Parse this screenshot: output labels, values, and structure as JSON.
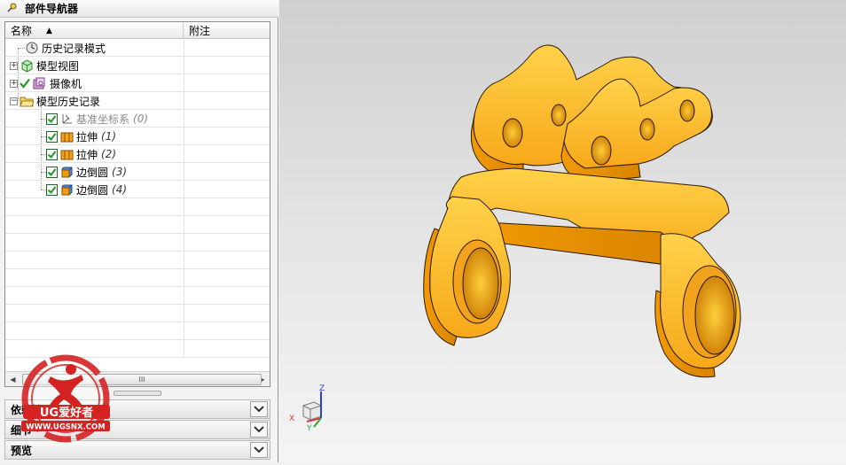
{
  "navigator": {
    "title": "部件导航器",
    "columns": {
      "name": "名称",
      "note": "附注"
    },
    "tree": [
      {
        "label": "历史记录模式",
        "count": ""
      },
      {
        "label": "模型视图",
        "count": ""
      },
      {
        "label": "摄像机",
        "count": ""
      },
      {
        "label": "模型历史记录",
        "count": ""
      },
      {
        "label": "基准坐标系",
        "count": "(0)"
      },
      {
        "label": "拉伸",
        "count": "(1)"
      },
      {
        "label": "拉伸",
        "count": "(2)"
      },
      {
        "label": "边倒圆",
        "count": "(3)"
      },
      {
        "label": "边倒圆",
        "count": "(4)"
      }
    ],
    "scroll_thumb": "III",
    "panels": [
      {
        "label": "依赖性"
      },
      {
        "label": "细节"
      },
      {
        "label": "预览"
      }
    ]
  },
  "watermark": {
    "brand": "UG爱好者",
    "url": "WWW.UGSNX.COM"
  },
  "triad": {
    "x": "X",
    "y": "Y",
    "z": "Z"
  },
  "colors": {
    "part": "#f39a06",
    "part_light": "#ffc233",
    "part_dark": "#b86a00",
    "check": "#1f9a1f"
  }
}
